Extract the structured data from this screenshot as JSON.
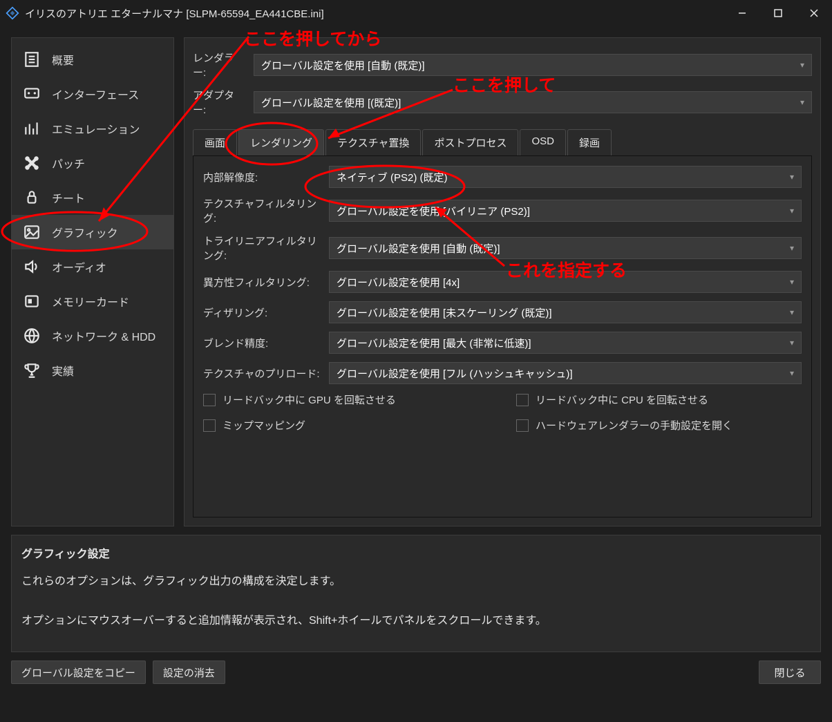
{
  "window": {
    "title": "イリスのアトリエ エターナルマナ [SLPM-65594_EA441CBE.ini]"
  },
  "sidebar": {
    "items": [
      {
        "label": "概要"
      },
      {
        "label": "インターフェース"
      },
      {
        "label": "エミュレーション"
      },
      {
        "label": "パッチ"
      },
      {
        "label": "チート"
      },
      {
        "label": "グラフィック"
      },
      {
        "label": "オーディオ"
      },
      {
        "label": "メモリーカード"
      },
      {
        "label": "ネットワーク & HDD"
      },
      {
        "label": "実績"
      }
    ]
  },
  "top_settings": {
    "renderer_label": "レンダラー:",
    "renderer_value": "グローバル設定を使用 [自動 (既定)]",
    "adapter_label": "アダプター:",
    "adapter_value": "グローバル設定を使用 [(既定)]"
  },
  "tabs": [
    "画面",
    "レンダリング",
    "テクスチャ置換",
    "ポストプロセス",
    "OSD",
    "録画"
  ],
  "active_tab": 1,
  "rendering": {
    "internal_res_label": "内部解像度:",
    "internal_res_value": "ネイティブ (PS2) (既定)",
    "tex_filter_label": "テクスチャフィルタリング:",
    "tex_filter_value": "グローバル設定を使用 [バイリニア (PS2)]",
    "trilinear_label": "トライリニアフィルタリング:",
    "trilinear_value": "グローバル設定を使用 [自動 (既定)]",
    "aniso_label": "異方性フィルタリング:",
    "aniso_value": "グローバル設定を使用 [4x]",
    "dither_label": "ディザリング:",
    "dither_value": "グローバル設定を使用 [未スケーリング (既定)]",
    "blend_label": "ブレンド精度:",
    "blend_value": "グローバル設定を使用 [最大 (非常に低速)]",
    "preload_label": "テクスチャのプリロード:",
    "preload_value": "グローバル設定を使用 [フル (ハッシュキャッシュ)]",
    "chk_gpu_readback": "リードバック中に GPU を回転させる",
    "chk_cpu_readback": "リードバック中に CPU を回転させる",
    "chk_mipmap": "ミップマッピング",
    "chk_hw_manual": "ハードウェアレンダラーの手動設定を開く"
  },
  "help": {
    "title": "グラフィック設定",
    "line1": "これらのオプションは、グラフィック出力の構成を決定します。",
    "line2": "オプションにマウスオーバーすると追加情報が表示され、Shift+ホイールでパネルをスクロールできます。"
  },
  "buttons": {
    "copy_global": "グローバル設定をコピー",
    "clear_settings": "設定の消去",
    "close": "閉じる"
  },
  "annotations": {
    "a1": "ここを押してから",
    "a2": "ここを押して",
    "a3": "これを指定する"
  }
}
